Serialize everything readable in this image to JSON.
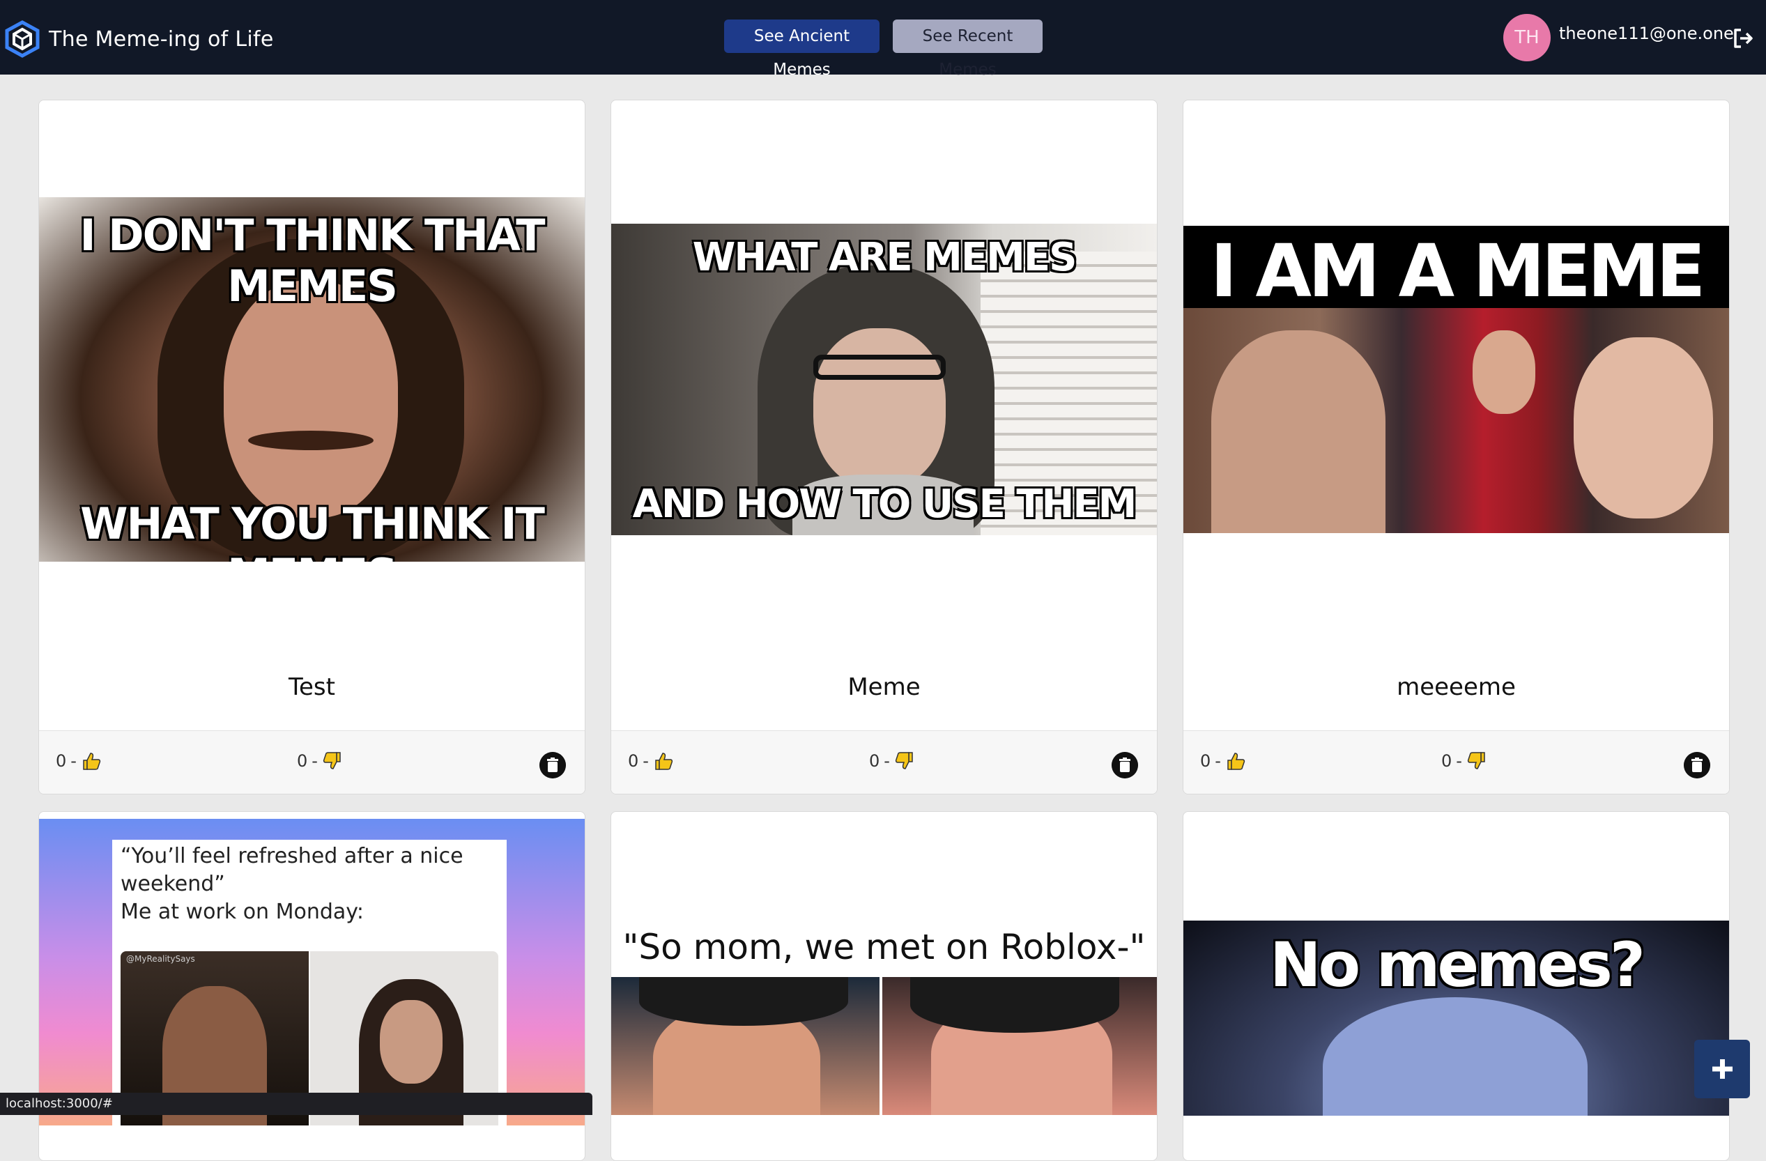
{
  "app": {
    "title": "The Meme-ing of Life",
    "logo_icon": "hexagon-cube-icon"
  },
  "nav": {
    "ancient_label": "See Ancient Memes",
    "recent_label": "See Recent Memes"
  },
  "user": {
    "initials": "TH",
    "email": "theone111@one.one",
    "avatar_color": "#e879a9"
  },
  "colors": {
    "navbar": "#111827",
    "primary_button": "#1e3a8a",
    "secondary_button": "#a5a8c0",
    "fab": "#1e3a6e"
  },
  "memes": [
    {
      "title": "Test",
      "top_text": "I DON'T THINK THAT MEMES",
      "bottom_text": "WHAT YOU THINK IT MEMES",
      "likes": "0",
      "dislikes": "0",
      "separator": "-"
    },
    {
      "title": "Meme",
      "top_text": "WHAT ARE MEMES",
      "bottom_text": "AND HOW TO USE THEM",
      "likes": "0",
      "dislikes": "0",
      "separator": "-"
    },
    {
      "title": "meeeeme",
      "top_text": "I AM A MEME",
      "bottom_text": "",
      "likes": "0",
      "dislikes": "0",
      "separator": "-"
    },
    {
      "title": "",
      "caption_line1": "“You’ll feel refreshed after a nice",
      "caption_line2": "weekend”",
      "caption_line3": "Me at work on Monday:",
      "watermark": "@MyRealitySays"
    },
    {
      "title": "",
      "top_text": "\"So mom, we met on Roblox-\""
    },
    {
      "title": "",
      "top_text": "No memes?"
    }
  ],
  "fab": {
    "icon": "plus-icon"
  },
  "status_bar": {
    "url": "localhost:3000/#"
  }
}
